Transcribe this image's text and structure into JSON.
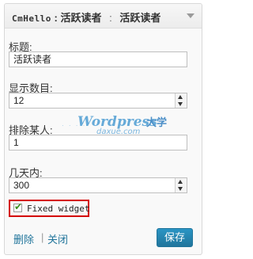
{
  "widget": {
    "name": "CmHello",
    "title_colon": ":",
    "instance_title": "活跃读者",
    "separator": ":",
    "subtitle": "活跃读者"
  },
  "form": {
    "title_label": "标题:",
    "title_value": "活跃读者",
    "count_label": "显示数目:",
    "count_value": "12",
    "exclude_label": "排除某人:",
    "exclude_value": "1",
    "days_label": "几天内:",
    "days_value": "300",
    "fixed_widget_label": "Fixed widget",
    "fixed_widget_checked": true
  },
  "watermark": {
    "brand": "Wordpress",
    "cn": "大学",
    "domain": "daxue.com"
  },
  "footer": {
    "delete_label": "删除",
    "separator": "|",
    "close_label": "关闭",
    "save_label": "保存"
  },
  "colors": {
    "link": "#21759b",
    "button": "#21759b",
    "highlight_border": "#d40000",
    "check": "#3a8f1d"
  },
  "icons": {
    "toggle": "triangle-down-icon",
    "spinner": "spinner-arrows-icon",
    "check": "checkmark-icon"
  }
}
